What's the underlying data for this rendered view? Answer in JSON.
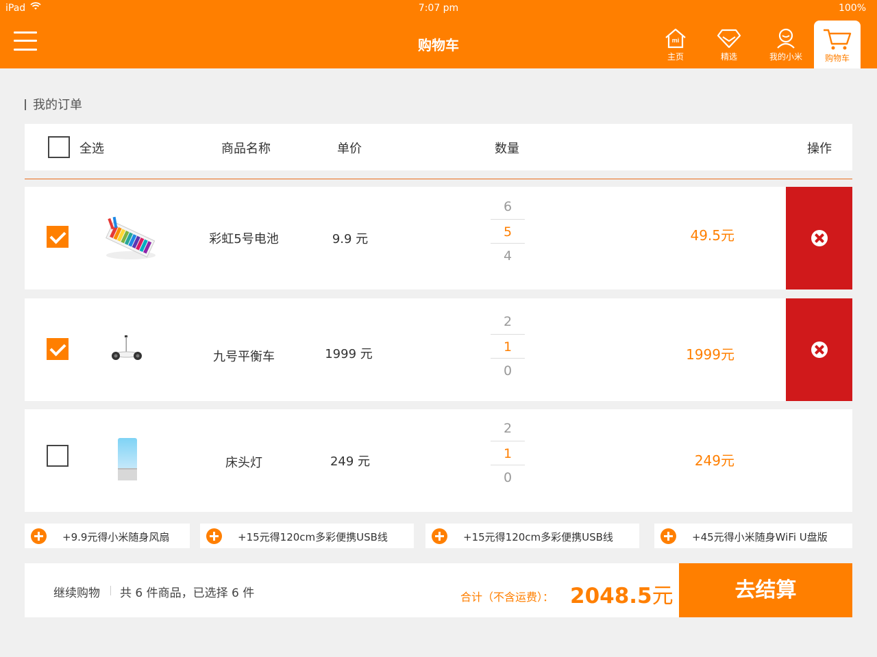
{
  "status": {
    "carrier": "iPad",
    "time": "7:07 pm",
    "battery": "100%"
  },
  "nav": {
    "title": "购物车",
    "tabs": [
      {
        "label": "主页",
        "icon": "home-icon",
        "logo": "mi"
      },
      {
        "label": "精选",
        "icon": "diamond-icon"
      },
      {
        "label": "我的小米",
        "icon": "user-icon"
      },
      {
        "label": "购物车",
        "icon": "cart-icon",
        "active": true
      }
    ]
  },
  "section": {
    "title": "我的订单"
  },
  "table": {
    "headers": {
      "select_all": "全选",
      "name": "商品名称",
      "price": "单价",
      "quantity": "数量",
      "action": "操作"
    },
    "rows": [
      {
        "checked": true,
        "image": "battery-pack-image",
        "name": "彩虹5号电池",
        "price": "9.9 元",
        "qty_above": "6",
        "qty": "5",
        "qty_below": "4",
        "subtotal": "49.5元",
        "deletable": true
      },
      {
        "checked": true,
        "image": "balance-scooter-image",
        "name": "九号平衡车",
        "price": "1999 元",
        "qty_above": "2",
        "qty": "1",
        "qty_below": "0",
        "subtotal": "1999元",
        "deletable": true
      },
      {
        "checked": false,
        "image": "bedside-lamp-image",
        "name": "床头灯",
        "price": "249 元",
        "qty_above": "2",
        "qty": "1",
        "qty_below": "0",
        "subtotal": "249元",
        "deletable": false
      }
    ]
  },
  "promos": [
    "+9.9元得小米随身风扇",
    "+15元得120cm多彩便携USB线",
    "+15元得120cm多彩便携USB线",
    "+45元得小米随身WiFi U盘版"
  ],
  "footer": {
    "continue": "继续购物",
    "summary": "共 6 件商品，已选择  6 件",
    "total_label": "合计（不含运费）：",
    "total_value": "2048.5",
    "total_unit": "元",
    "checkout": "去结算"
  },
  "colors": {
    "accent": "#ff7f00",
    "delete": "#d0191b"
  }
}
